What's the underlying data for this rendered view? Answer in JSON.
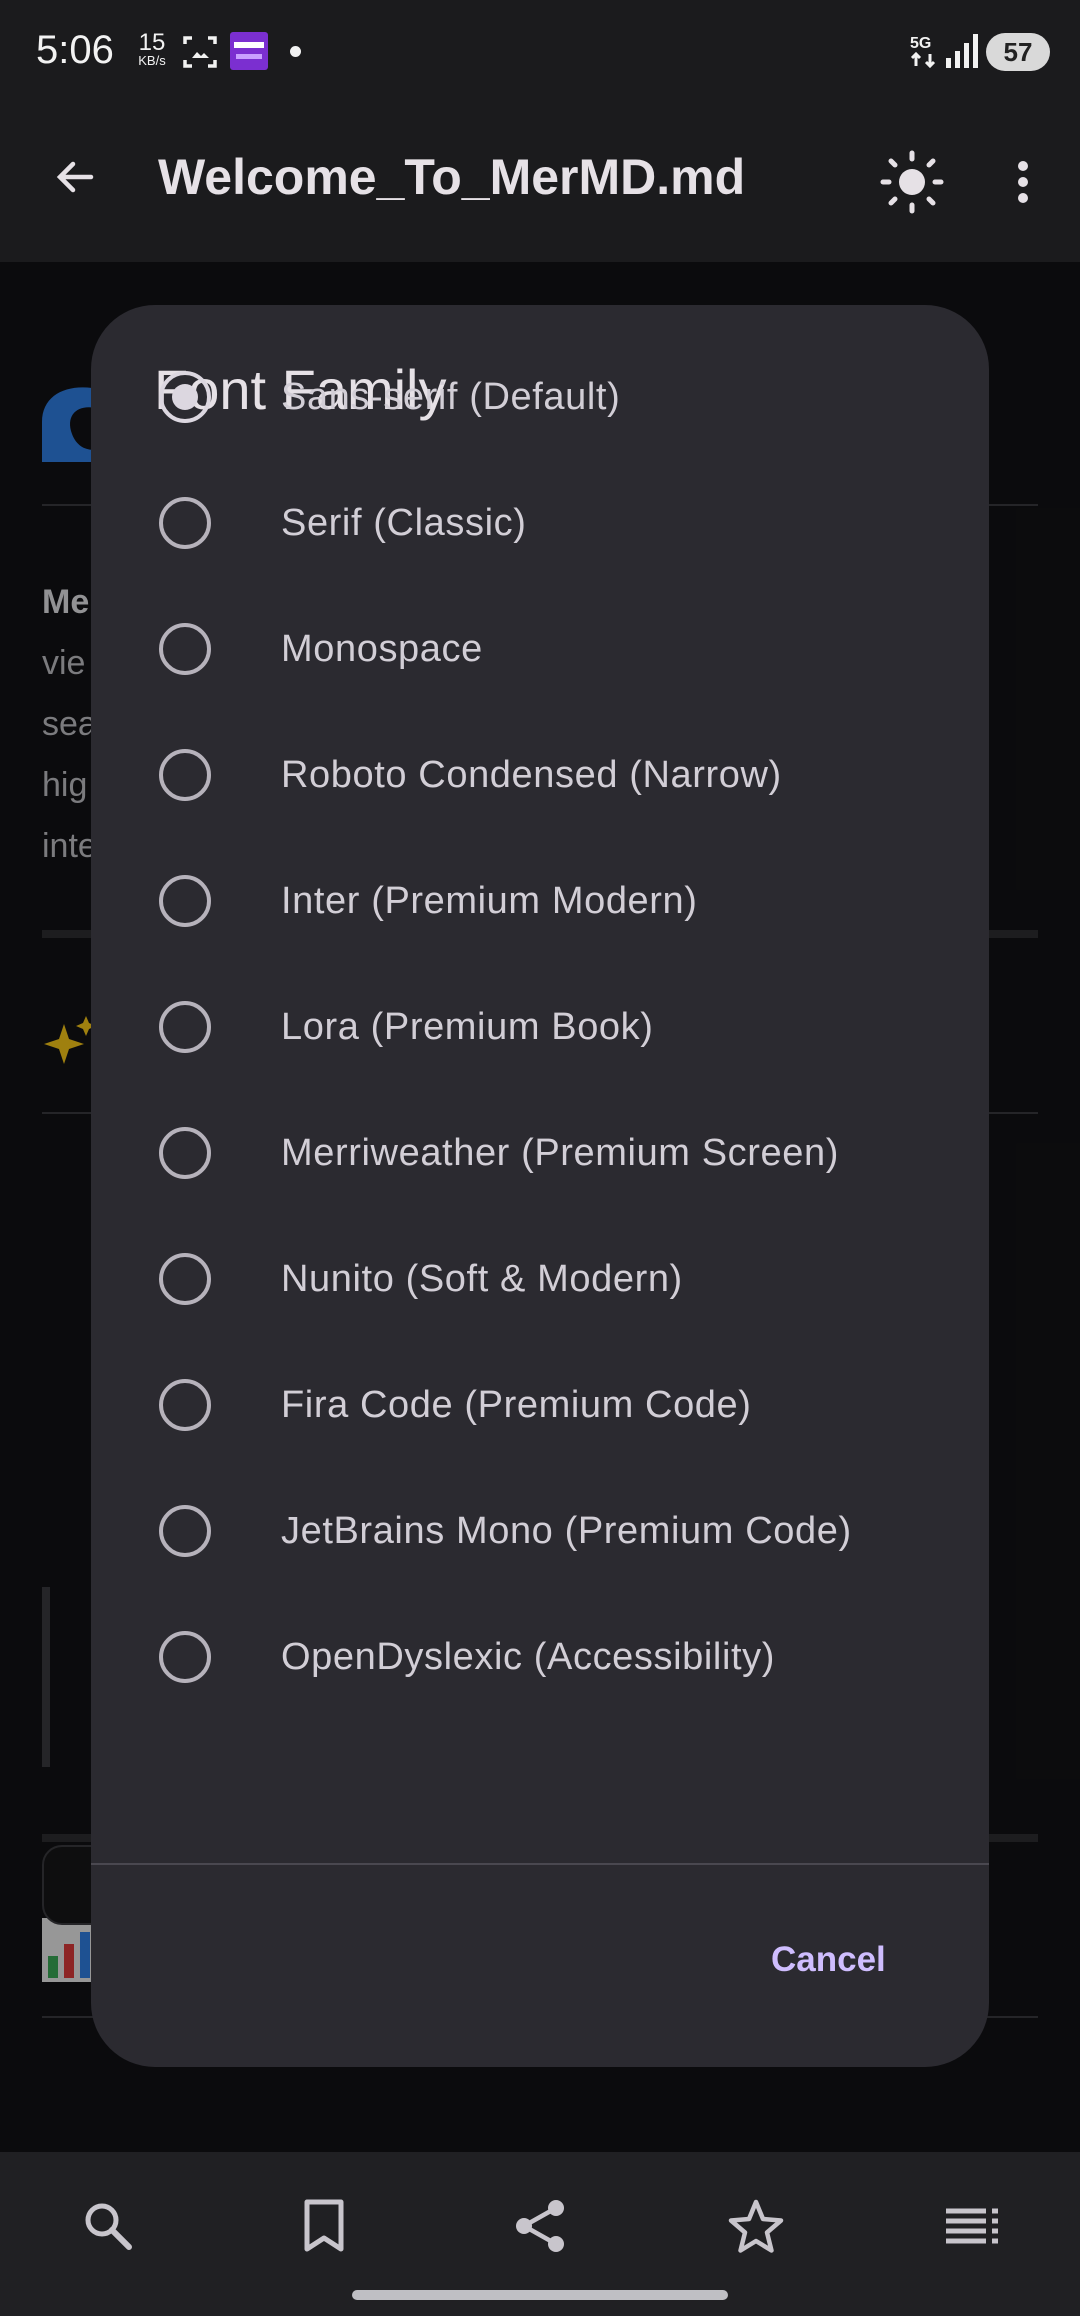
{
  "status_bar": {
    "time": "5:06",
    "net_speed_value": "15",
    "net_speed_unit": "KB/s",
    "battery": "57",
    "icons": [
      "screenshot-icon",
      "times-prime-app-icon",
      "notification-dot-icon",
      "5g-icon",
      "signal-icon",
      "battery-icon"
    ]
  },
  "app_bar": {
    "title": "Welcome_To_MerMD.md",
    "icons": [
      "back-arrow-icon",
      "brightness-icon",
      "more-vert-icon"
    ]
  },
  "dialog": {
    "title": "Font Family",
    "selected_index": 0,
    "options": [
      {
        "label": "Sans-serif (Default)",
        "selected": true
      },
      {
        "label": "Serif (Classic)",
        "selected": false
      },
      {
        "label": "Monospace",
        "selected": false
      },
      {
        "label": "Roboto Condensed (Narrow)",
        "selected": false
      },
      {
        "label": "Inter (Premium Modern)",
        "selected": false
      },
      {
        "label": "Lora (Premium Book)",
        "selected": false
      },
      {
        "label": "Merriweather (Premium Screen)",
        "selected": false
      },
      {
        "label": "Nunito (Soft & Modern)",
        "selected": false
      },
      {
        "label": "Fira Code (Premium Code)",
        "selected": false
      },
      {
        "label": "JetBrains Mono (Premium Code)",
        "selected": false
      },
      {
        "label": "OpenDyslexic (Accessibility)",
        "selected": false
      }
    ],
    "cancel_label": "Cancel"
  },
  "background_doc": {
    "text_lines": [
      "Me",
      "vie",
      "sea",
      "hig",
      "inte"
    ]
  },
  "bottom_bar": {
    "icons": [
      "search-icon",
      "bookmark-icon",
      "share-icon",
      "star-icon",
      "toc-list-icon"
    ]
  },
  "colors": {
    "dialog_bg": "#2b2a30",
    "accent": "#cfbdfe",
    "app_bar_bg": "#1b1b1d",
    "bottom_bar_bg": "#202023"
  }
}
